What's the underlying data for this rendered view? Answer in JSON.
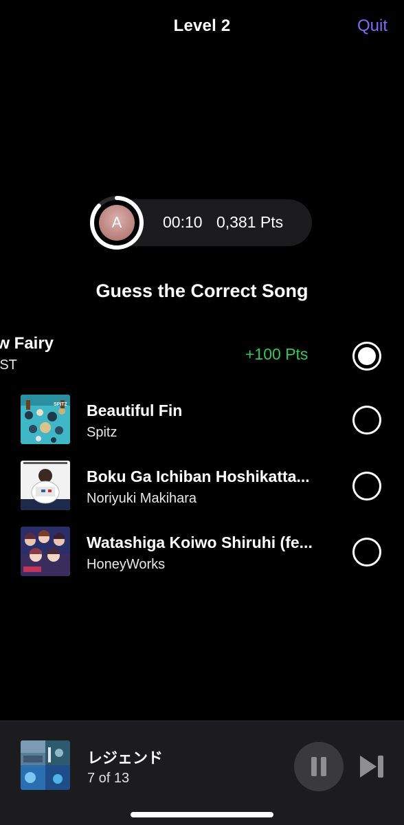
{
  "header": {
    "level_title": "Level 2",
    "quit_label": "Quit"
  },
  "player": {
    "avatar_initial": "A",
    "time": "00:10",
    "points": "0,381 Pts",
    "timer_progress": 0.87
  },
  "question": "Guess the Correct Song",
  "answers": [
    {
      "title": "now Fairy",
      "artist": "NKIST",
      "points_awarded": "+100 Pts",
      "selected": true
    },
    {
      "title": "Beautiful Fin",
      "artist": "Spitz",
      "selected": false
    },
    {
      "title": "Boku Ga Ichiban Hoshikatta...",
      "artist": "Noriyuki Makihara",
      "selected": false
    },
    {
      "title": "Watashiga Koiwo Shiruhi (fe...",
      "artist": "HoneyWorks",
      "selected": false
    }
  ],
  "cover_labels": {
    "beautiful_fin": "SPITZ"
  },
  "now_playing": {
    "title": "レジェンド",
    "track_position": "7 of 13"
  },
  "colors": {
    "accent": "#7b6cf6",
    "points_green": "#34c759",
    "background": "#000000",
    "bar_background": "#1c1c1e"
  },
  "icons": {
    "pause": "pause-icon",
    "skip": "skip-forward-icon"
  }
}
